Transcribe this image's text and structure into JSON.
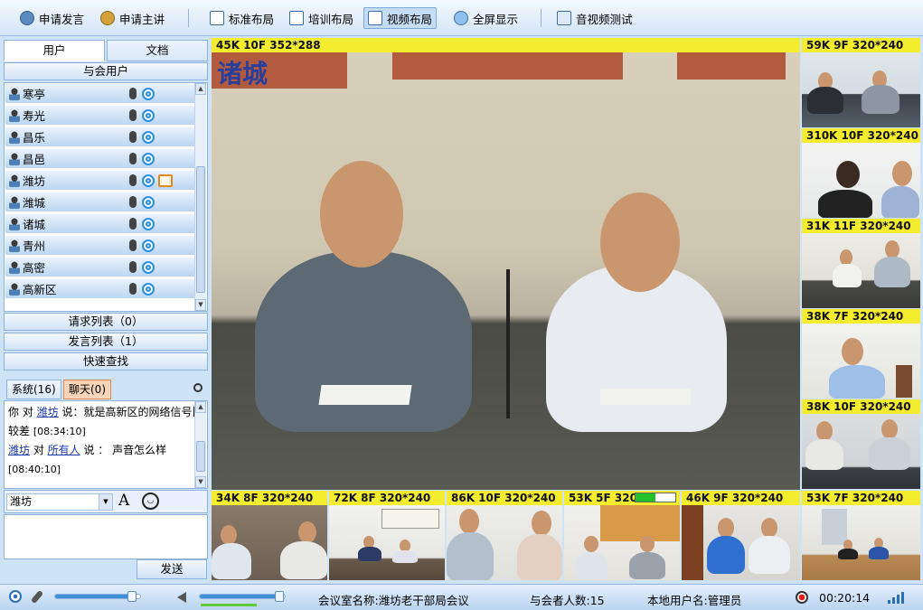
{
  "toolbar": {
    "buttons": [
      {
        "label": "申请发言",
        "icon": "raise-hand-icon"
      },
      {
        "label": "申请主讲",
        "icon": "presenter-icon"
      },
      {
        "label": "标准布局",
        "icon": "standard-layout-icon"
      },
      {
        "label": "培训布局",
        "icon": "training-layout-icon"
      },
      {
        "label": "视频布局",
        "icon": "video-layout-icon"
      },
      {
        "label": "全屏显示",
        "icon": "fullscreen-icon"
      },
      {
        "label": "音视频测试",
        "icon": "av-test-icon"
      }
    ],
    "active": "视频布局"
  },
  "left_panel": {
    "tabs": [
      "用户",
      "文档"
    ],
    "active_tab": "用户",
    "participants_header": "与会用户",
    "users": [
      {
        "name": "寒亭"
      },
      {
        "name": "寿光"
      },
      {
        "name": "昌乐"
      },
      {
        "name": "昌邑"
      },
      {
        "name": "潍坊",
        "editing": true
      },
      {
        "name": "潍城"
      },
      {
        "name": "诸城"
      },
      {
        "name": "青州"
      },
      {
        "name": "高密"
      },
      {
        "name": "高新区"
      }
    ],
    "request_list": "请求列表（0）",
    "speak_list": "发言列表（1）",
    "quick_search": "快速查找",
    "chat_tabs": [
      "系统(16)",
      "聊天(0)"
    ],
    "active_chat_tab": "聊天(0)",
    "messages": [
      {
        "p1": "你 对 ",
        "link1": "潍坊",
        "p2": " 说：就是高新区的网络信号比较差 ",
        "time": "[08:34:10]"
      },
      {
        "link0": "潍坊",
        "p1": " 对 ",
        "link1": "所有人",
        "p2": " 说 ： 声音怎么样",
        "time": "[08:40:10]"
      }
    ],
    "recipient": "潍坊",
    "font_btn": "A",
    "send_label": "发送"
  },
  "video": {
    "main_label": "45K 10F 352*288",
    "main_sign": "诸城",
    "right_labels": [
      "59K 9F 320*240",
      "310K 10F 320*240",
      "31K 11F 320*240",
      "38K 7F 320*240",
      "38K 10F 320*240"
    ],
    "bottom_labels": [
      "34K 8F 320*240",
      "72K 8F 320*240",
      "86K 10F 320*240",
      "53K 5F 320*",
      "46K 9F 320*240",
      "53K 7F 320*240"
    ],
    "buffer_level": 0.5
  },
  "status_bar": {
    "mic_volume": 0.92,
    "speaker_volume": 0.95,
    "meeting_room": "会议室名称:潍坊老干部局会议",
    "attendees": "与会者人数:15",
    "local_user": "本地用户名:管理员",
    "elapsed": "00:20:14"
  },
  "colors": {
    "label_bg": "#f4ed2f",
    "accent": "#3d8fd6",
    "record": "#e21a1a"
  }
}
